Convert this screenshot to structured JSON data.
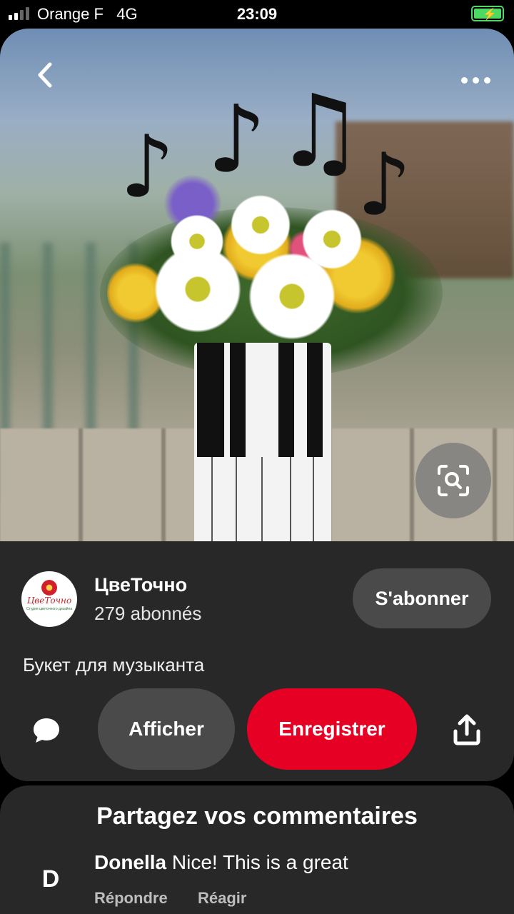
{
  "status_bar": {
    "carrier": "Orange F",
    "network": "4G",
    "time": "23:09",
    "signal_bars": 4,
    "signal_active": 2,
    "battery_charging": true,
    "battery_color": "#4cd964"
  },
  "pin": {
    "image_description_icon": "photo",
    "title": "Букет для музыканта",
    "back_icon": "chevron-left-icon",
    "more_icon": "more-dots-icon",
    "visual_search_icon": "lens-icon"
  },
  "profile": {
    "avatar_logo_text": "ЦвеТочно",
    "avatar_logo_subtext": "Студия цветочного дизайна",
    "name": "ЦвеТочно",
    "followers": "279 abonnés",
    "follow_label": "S'abonner"
  },
  "actions": {
    "comment_icon": "speech-bubble-icon",
    "view_label": "Afficher",
    "save_label": "Enregistrer",
    "share_icon": "share-icon",
    "save_color": "#e60023"
  },
  "comments": {
    "title": "Partagez vos commentaires",
    "items": [
      {
        "avatar_letter": "D",
        "author": "Donella",
        "text": "Nice! This is a great",
        "reply_label": "Répondre",
        "react_label": "Réagir"
      }
    ]
  }
}
